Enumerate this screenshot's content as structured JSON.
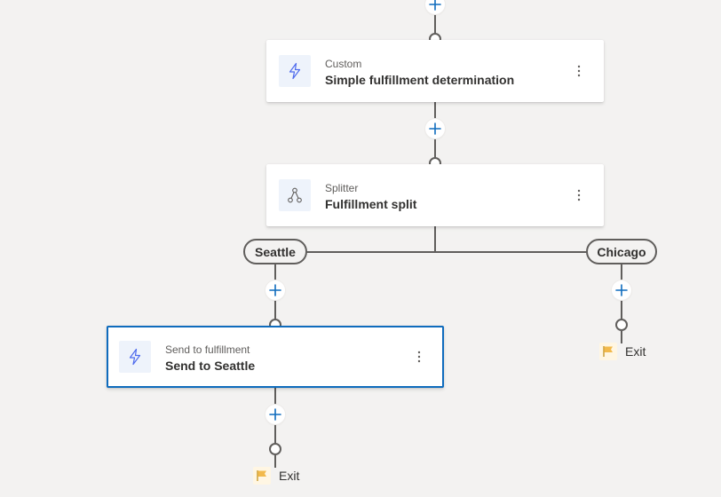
{
  "colors": {
    "canvas_bg": "#f3f2f1",
    "connector": "#605e5c",
    "accent_blue": "#0f6cbd",
    "exit_flag": "#f2b94b"
  },
  "steps": [
    {
      "id": "custom",
      "kind": "Custom",
      "name": "Simple fulfillment determination",
      "icon": "lightning-icon",
      "selected": false
    },
    {
      "id": "splitter",
      "kind": "Splitter",
      "name": "Fulfillment split",
      "icon": "splitter-icon",
      "selected": false
    },
    {
      "id": "send",
      "kind": "Send to fulfillment",
      "name": "Send to Seattle",
      "icon": "lightning-icon",
      "selected": true
    }
  ],
  "branches": [
    {
      "label": "Seattle"
    },
    {
      "label": "Chicago"
    }
  ],
  "exits": [
    {
      "label": "Exit",
      "icon": "flag-icon"
    },
    {
      "label": "Exit",
      "icon": "flag-icon"
    }
  ],
  "add_step_buttons": {
    "icon": "plus-icon",
    "count": 5
  },
  "more_menu": {
    "icon": "more-vertical-icon"
  }
}
